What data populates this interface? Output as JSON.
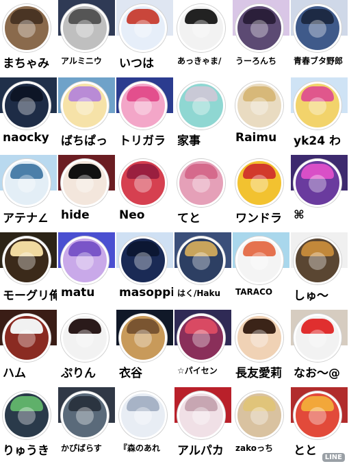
{
  "watermark": "LINE",
  "cells": [
    {
      "name": "まちゃみ",
      "size": "big",
      "banner": "#ffffff",
      "avatar": "#8a6a4c",
      "hair": "#4a3524"
    },
    {
      "name": "アルミニウ",
      "size": "small",
      "banner": "#2f3a55",
      "avatar": "#bfbfbf",
      "hair": "#555555"
    },
    {
      "name": "いつは",
      "size": "big",
      "banner": "#dfe6f2",
      "avatar": "#e6eef9",
      "hair": "#c9463b"
    },
    {
      "name": "あっきゃま/",
      "size": "small",
      "banner": "#ffffff",
      "avatar": "#f2f2f2",
      "hair": "#222222"
    },
    {
      "name": "うーろんち",
      "size": "small",
      "banner": "#d9c6e6",
      "avatar": "#5c4a73",
      "hair": "#2b1f3a"
    },
    {
      "name": "青春ブタ野郎",
      "size": "small",
      "banner": "#cfd8e8",
      "avatar": "#3f5a8a",
      "hair": "#1d2a44"
    },
    {
      "name": "naocky",
      "size": "big",
      "banner": "#20304a",
      "avatar": "#1e2c46",
      "hair": "#0d1526"
    },
    {
      "name": "ばちぱっ",
      "size": "big",
      "banner": "#6fa2c9",
      "avatar": "#f6e2a8",
      "hair": "#b98bd6"
    },
    {
      "name": "トリガラ",
      "size": "big",
      "banner": "#2b3c8f",
      "avatar": "#f3a6c8",
      "hair": "#e34f8d"
    },
    {
      "name": "家事",
      "size": "big",
      "banner": "#ffffff",
      "avatar": "#8fd7d2",
      "hair": "#c9c9d6"
    },
    {
      "name": "Raimu",
      "size": "big",
      "banner": "#ffffff",
      "avatar": "#e9dbc1",
      "hair": "#d7b879"
    },
    {
      "name": "yk24 わ",
      "size": "big",
      "banner": "#cfe3f5",
      "avatar": "#f2d36b",
      "hair": "#e0578c"
    },
    {
      "name": "アテナ∠",
      "size": "big",
      "banner": "#b9d9ef",
      "avatar": "#e3eef6",
      "hair": "#4c7fa9"
    },
    {
      "name": "hide",
      "size": "big",
      "banner": "#6b1d22",
      "avatar": "#f3e6dc",
      "hair": "#111111"
    },
    {
      "name": "Neo",
      "size": "big",
      "banner": "#ffffff",
      "avatar": "#d64050",
      "hair": "#9a1f3f"
    },
    {
      "name": "てと",
      "size": "big",
      "banner": "#ffffff",
      "avatar": "#e5a0b8",
      "hair": "#d56a8c"
    },
    {
      "name": "ワンドラ",
      "size": "big",
      "banner": "#ffffff",
      "avatar": "#f2c230",
      "hair": "#d23a2b"
    },
    {
      "name": "⌘",
      "size": "big",
      "banner": "#3d2a6e",
      "avatar": "#6a3b9e",
      "hair": "#d94fc7"
    },
    {
      "name": "モーグリ俺",
      "size": "big",
      "banner": "#2c2417",
      "avatar": "#3b2a1a",
      "hair": "#f0d9a0"
    },
    {
      "name": "matu",
      "size": "big",
      "banner": "#4a4fd1",
      "avatar": "#c9a9e9",
      "hair": "#7a55c8"
    },
    {
      "name": "masoppi",
      "size": "big",
      "banner": "#cfe0f3",
      "avatar": "#1a2a55",
      "hair": "#0c1733"
    },
    {
      "name": "はく/Haku",
      "size": "small",
      "banner": "#3b4f7a",
      "avatar": "#2d3f63",
      "hair": "#c8a45c"
    },
    {
      "name": "TARACO",
      "size": "small",
      "banner": "#a9d7ec",
      "avatar": "#f4f4f4",
      "hair": "#e5724f"
    },
    {
      "name": "しゅ～",
      "size": "big",
      "banner": "#f0f0f0",
      "avatar": "#5a4632",
      "hair": "#c2883a"
    },
    {
      "name": "ハム",
      "size": "big",
      "banner": "#3a1d16",
      "avatar": "#8a2b22",
      "hair": "#f1f1f1"
    },
    {
      "name": "ぷりん",
      "size": "big",
      "banner": "#ffffff",
      "avatar": "#f2f2f2",
      "hair": "#2a1a1a"
    },
    {
      "name": "衣谷",
      "size": "big",
      "banner": "#101828",
      "avatar": "#c89a5a",
      "hair": "#7a5531"
    },
    {
      "name": "☆パイセン",
      "size": "small",
      "banner": "#2f2a55",
      "avatar": "#8a2f5a",
      "hair": "#d94a63"
    },
    {
      "name": "長友愛莉",
      "size": "big",
      "banner": "#ffffff",
      "avatar": "#f0d2b5",
      "hair": "#3b2418"
    },
    {
      "name": "なお～@",
      "size": "big",
      "banner": "#d6ccc0",
      "avatar": "#f2f2f2",
      "hair": "#e02f2f"
    },
    {
      "name": "りゅうき",
      "size": "big",
      "banner": "#ffffff",
      "avatar": "#2a3a4a",
      "hair": "#5fb06a"
    },
    {
      "name": "かぴばらす",
      "size": "small",
      "banner": "#303846",
      "avatar": "#5a6a7a",
      "hair": "#2b3440"
    },
    {
      "name": "『森のあれ",
      "size": "small",
      "banner": "#ffffff",
      "avatar": "#e8edf4",
      "hair": "#a7b3c6"
    },
    {
      "name": "アルパカ",
      "size": "big",
      "banner": "#b9202a",
      "avatar": "#f0e0e6",
      "hair": "#c7a6b2"
    },
    {
      "name": "zakoっち",
      "size": "small",
      "banner": "#ffffff",
      "avatar": "#d9c2a0",
      "hair": "#e0c47a"
    },
    {
      "name": "とと",
      "size": "big",
      "banner": "#b12c2c",
      "avatar": "#e24a3a",
      "hair": "#f2a73a"
    }
  ]
}
